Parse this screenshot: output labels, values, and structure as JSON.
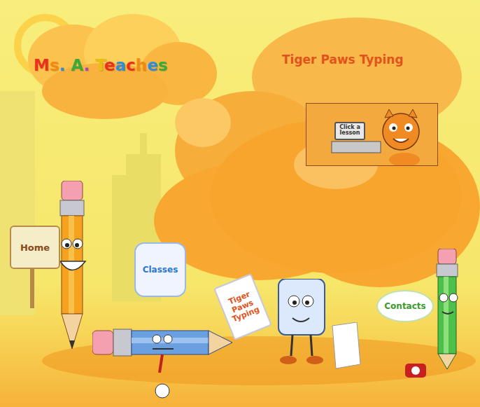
{
  "header": {
    "title": "Ms. A. Teaches"
  },
  "banner": {
    "title": "Tiger Paws Typing",
    "lesson_sign": "Click a lesson"
  },
  "nav": [
    {
      "label": "Home",
      "kind": "board"
    },
    {
      "label": "Classes",
      "kind": "card"
    },
    {
      "label": "Tiger Paws Typing",
      "kind": "flag"
    },
    {
      "label": "Contacts",
      "kind": "bubble"
    }
  ]
}
